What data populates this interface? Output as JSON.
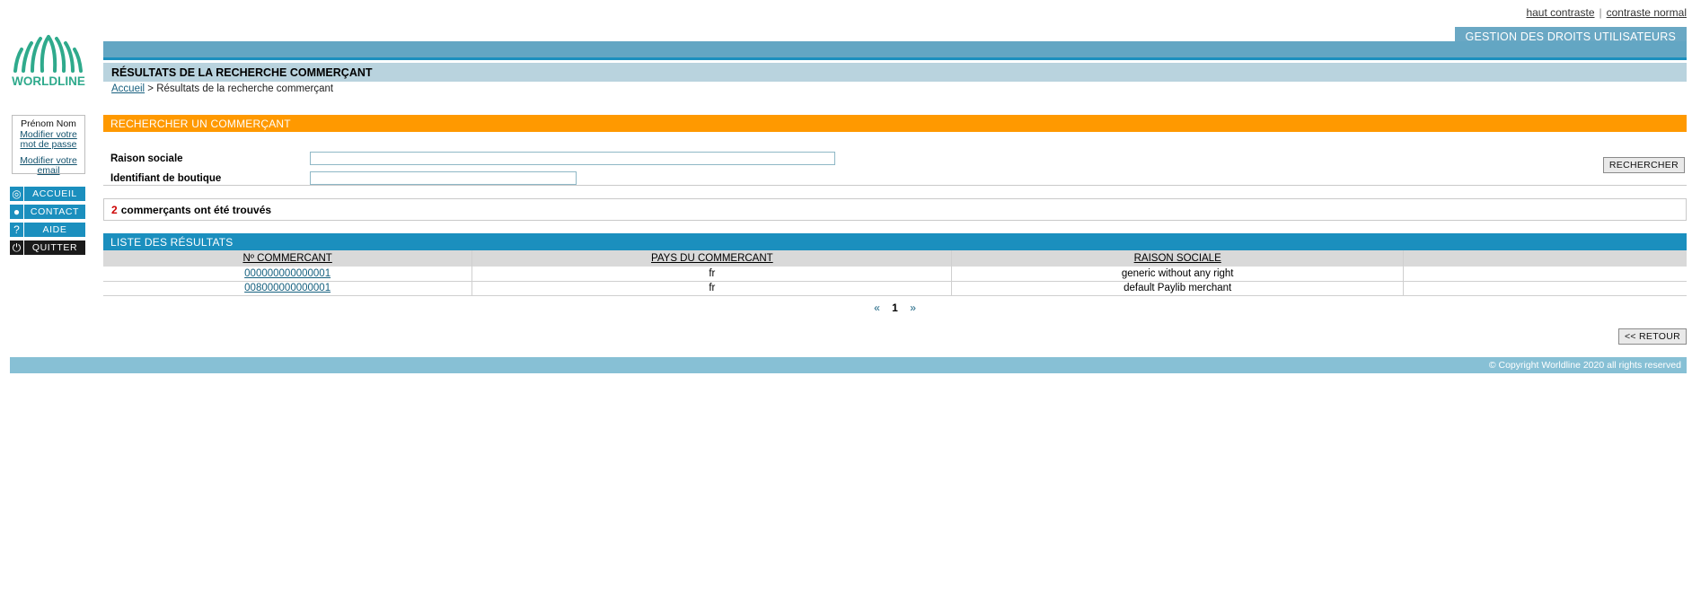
{
  "topbar": {
    "high_contrast": "haut contraste",
    "separator": "|",
    "normal_contrast": "contraste normal",
    "app_tab": "GESTION DES DROITS UTILISATEURS"
  },
  "brand": {
    "name_bold": "WORLD",
    "name_light": "LINE",
    "color": "#2faa8c"
  },
  "header": {
    "page_title": "RÉSULTATS DE LA RECHERCHE COMMERÇANT",
    "breadcrumb_home": "Accueil",
    "breadcrumb_sep": ">",
    "breadcrumb_current": "Résultats de la recherche commerçant"
  },
  "sidebar": {
    "user_name": "Prénom Nom",
    "change_password": "Modifier votre mot de passe",
    "change_email": "Modifier votre email",
    "items": [
      {
        "label": "ACCUEIL",
        "icon": "target-icon",
        "glyph": "◎"
      },
      {
        "label": "CONTACT",
        "icon": "speech-bubble-icon",
        "glyph": "●"
      },
      {
        "label": "AIDE",
        "icon": "question-mark-icon",
        "glyph": "?"
      },
      {
        "label": "QUITTER",
        "icon": "power-off-icon",
        "glyph": "⏻"
      }
    ]
  },
  "search": {
    "section_title": "RECHERCHER UN COMMERÇANT",
    "raison_sociale_label": "Raison sociale",
    "raison_sociale_value": "",
    "raison_sociale_placeholder": "",
    "boutique_label": "Identifiant de boutique",
    "boutique_value": "",
    "boutique_placeholder": "",
    "submit_label": "RECHERCHER"
  },
  "results": {
    "count": "2",
    "count_text": "commerçants ont été trouvés",
    "section_title": "LISTE DES RÉSULTATS",
    "columns": [
      "Nº COMMERCANT",
      "PAYS DU COMMERCANT",
      "RAISON SOCIALE"
    ],
    "rows": [
      {
        "merchant_id": "000000000000001",
        "country": "fr",
        "company": "generic without any right"
      },
      {
        "merchant_id": "008000000000001",
        "country": "fr",
        "company": "default Paylib merchant"
      }
    ],
    "pager": {
      "prev": "«",
      "current": "1",
      "next": "»"
    },
    "back_label": "<< RETOUR"
  },
  "footer": {
    "copyright": "© Copyright Worldline 2020 all rights reserved"
  }
}
